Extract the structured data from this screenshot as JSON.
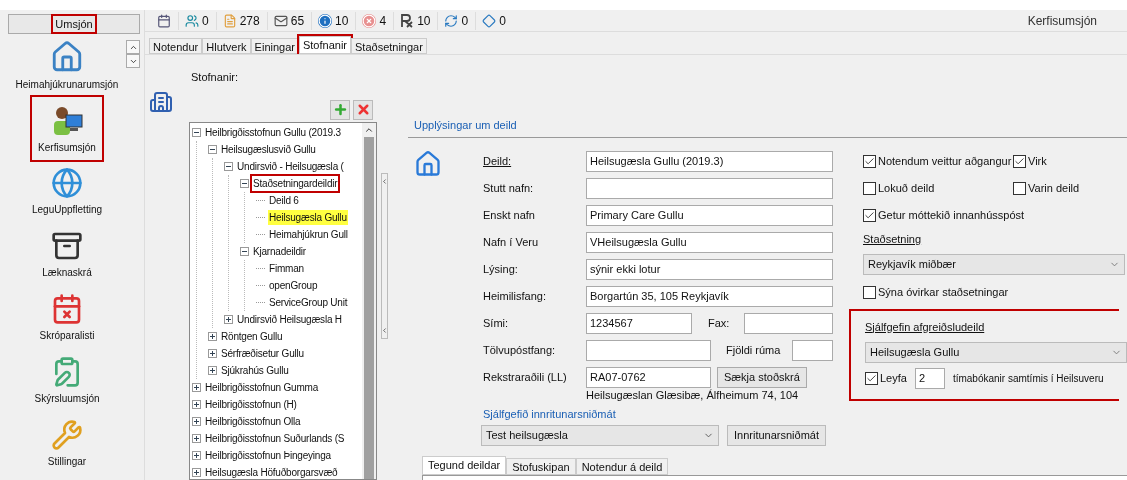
{
  "sidebar": {
    "header": {
      "label": "Umsjón",
      "annotated": true
    },
    "items": [
      {
        "label": "Heimahjúkrunarumsjón",
        "annotated": false
      },
      {
        "label": "Kerfisumsjón",
        "annotated": true
      },
      {
        "label": "LeguUppfletting",
        "annotated": false
      },
      {
        "label": "Læknaskrá",
        "annotated": false
      },
      {
        "label": "Skróparalisti",
        "annotated": false
      },
      {
        "label": "Skýrsluumsjón",
        "annotated": false
      },
      {
        "label": "Stillingar",
        "annotated": false
      }
    ]
  },
  "toolbar": {
    "counters": [
      "0",
      "278",
      "65",
      "10",
      "4",
      "10",
      "0",
      "0"
    ],
    "title": "Kerfisumsjón"
  },
  "tabs": [
    {
      "label": "Notendur",
      "selected": false,
      "annotated": false
    },
    {
      "label": "Hlutverk",
      "selected": false,
      "annotated": false
    },
    {
      "label": "Einingar",
      "selected": false,
      "annotated": false
    },
    {
      "label": "Stofnanir",
      "selected": true,
      "annotated": true
    },
    {
      "label": "Staðsetningar",
      "selected": false,
      "annotated": false
    }
  ],
  "organizations": {
    "label": "Stofnanir:",
    "tree": [
      {
        "label": "Heilbrigðisstofnun Gullu (2019.3",
        "expanded": true,
        "selected": false,
        "annotated": false,
        "children": [
          {
            "label": "Heilsugæslusvið Gullu",
            "expanded": true,
            "selected": false,
            "annotated": false,
            "children": [
              {
                "label": "Undirsvið - Heilsugæsla (",
                "expanded": true,
                "selected": false,
                "annotated": false,
                "children": [
                  {
                    "label": "Staðsetningardeildir",
                    "expanded": true,
                    "selected": false,
                    "annotated": true,
                    "children": [
                      {
                        "label": "Deild 6",
                        "selected": false,
                        "annotated": false
                      },
                      {
                        "label": "Heilsugæsla Gullu",
                        "selected": true,
                        "annotated": false
                      },
                      {
                        "label": "Heimahjúkrun Gull",
                        "selected": false,
                        "annotated": false
                      }
                    ]
                  },
                  {
                    "label": "Kjarnadeildir",
                    "expanded": true,
                    "selected": false,
                    "annotated": false,
                    "children": [
                      {
                        "label": "Fimman",
                        "selected": false,
                        "annotated": false
                      },
                      {
                        "label": "openGroup",
                        "selected": false,
                        "annotated": false
                      },
                      {
                        "label": "ServiceGroup Unit",
                        "selected": false,
                        "annotated": false
                      }
                    ]
                  }
                ]
              },
              {
                "label": "Undirsvið Heilsugæsla H",
                "expanded": false,
                "selected": false,
                "annotated": false
              }
            ]
          },
          {
            "label": "Röntgen Gullu",
            "expanded": false,
            "selected": false,
            "annotated": false
          },
          {
            "label": "Sérfræðisetur Gullu",
            "expanded": false,
            "selected": false,
            "annotated": false
          },
          {
            "label": "Sjúkrahús Gullu",
            "expanded": false,
            "selected": false,
            "annotated": false
          }
        ]
      },
      {
        "label": "Heilbrigðisstofnun Gumma",
        "expanded": false,
        "selected": false,
        "annotated": false
      },
      {
        "label": "Heilbrigðisstofnun (H)",
        "expanded": false,
        "selected": false,
        "annotated": false
      },
      {
        "label": "Heilbrigðisstofnun Olla",
        "expanded": false,
        "selected": false,
        "annotated": false
      },
      {
        "label": "Heilbrigðisstofnun Suðurlands (S",
        "expanded": false,
        "selected": false,
        "annotated": false
      },
      {
        "label": "Heilbrigðisstofnun Þingeyinga",
        "expanded": false,
        "selected": false,
        "annotated": false
      },
      {
        "label": "Heilsugæsla Höfuðborgarsvæð",
        "expanded": false,
        "selected": false,
        "annotated": false
      }
    ]
  },
  "department": {
    "section_title": "Upplýsingar um deild",
    "fields": [
      {
        "kind": "text",
        "label": "Deild:",
        "underlined": true,
        "value": "Heilsugæsla Gullu (2019.3)"
      },
      {
        "kind": "text",
        "label": "Stutt nafn:",
        "underlined": false
      },
      {
        "kind": "text",
        "label": "Enskt nafn",
        "underlined": false,
        "value": "Primary Care Gullu"
      },
      {
        "kind": "text",
        "label": "Nafn í Veru",
        "underlined": false,
        "value": "VHeilsugæsla Gullu"
      },
      {
        "kind": "text",
        "label": "Lýsing:",
        "underlined": false,
        "value": "sýnir ekki lotur"
      },
      {
        "kind": "text",
        "label": "Heimilisfang:",
        "underlined": false,
        "value": "Borgartún 35, 105 Reykjavík"
      },
      {
        "kind": "pair",
        "label": "Sími:",
        "underlined": false,
        "value": "1234567",
        "label2": "Fax:"
      },
      {
        "kind": "pair-small",
        "label": "Tölvupóstfang:",
        "underlined": false,
        "label2": "Fjöldi rúma"
      },
      {
        "kind": "button",
        "label": "Rekstraraðili (LL)",
        "underlined": false,
        "value": "RA07-0762",
        "button": "Sækja stoðskrá",
        "note": "Heilsugæslan Glæsibæ, Álfheimum 74, 104"
      }
    ],
    "template": {
      "label": "Sjálfgefið innritunarsniðmát",
      "value": "Test heilsugæsla",
      "button": "Innritunarsniðmát"
    },
    "checkbox_rows": [
      [
        {
          "label": "Notendum veittur aðgangur",
          "checked": true
        },
        {
          "label": "Virk",
          "checked": true
        }
      ],
      [
        {
          "label": "Lokuð deild",
          "checked": false
        },
        {
          "label": "Varin deild",
          "checked": false
        }
      ],
      [
        {
          "label": "Getur móttekið innanhússpóst",
          "checked": true
        }
      ]
    ],
    "location": {
      "label": "Staðsetning",
      "value": "Reykjavík miðbær",
      "show_inactive": {
        "label": "Sýna óvirkar staðsetningar",
        "checked": false
      }
    },
    "default_unit": {
      "annotated": true,
      "label": "Sjálfgefin afgreiðsludeild",
      "value": "Heilsugæsla Gullu",
      "allow": {
        "label": "Leyfa",
        "checked": true,
        "value": "2",
        "suffix": "tímabókanir samtímis í Heilsuveru"
      }
    },
    "bottom_tabs": [
      {
        "label": "Tegund deildar",
        "selected": true
      },
      {
        "label": "Stofuskipan",
        "selected": false
      },
      {
        "label": "Notendur á deild",
        "selected": false
      }
    ]
  }
}
